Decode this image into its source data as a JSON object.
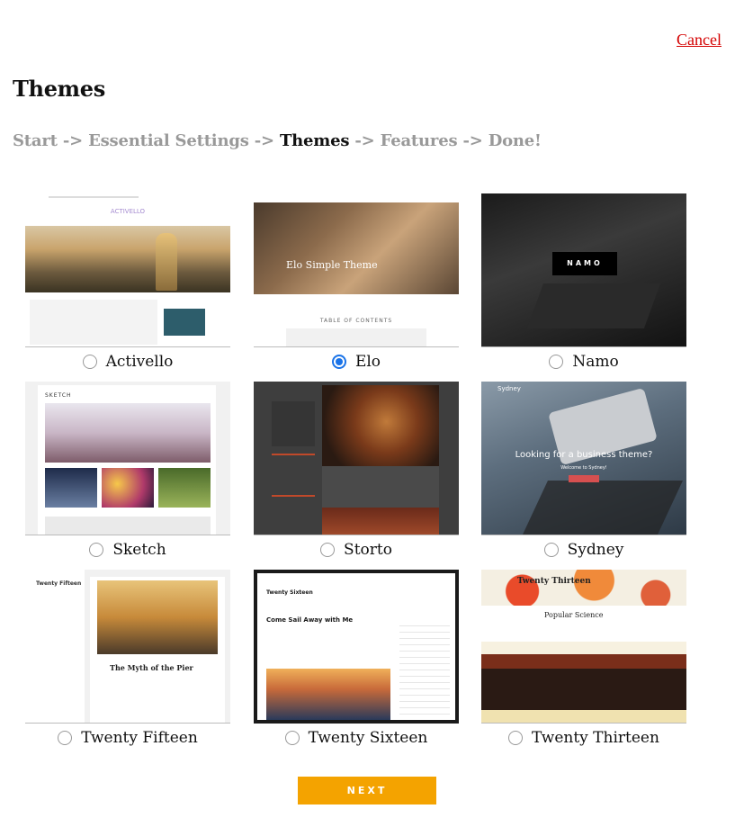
{
  "header": {
    "cancel_label": "Cancel",
    "title": "Themes"
  },
  "steps": {
    "s1": "Start",
    "s2": "Essential Settings",
    "s3": "Themes",
    "s4": "Features",
    "s5": "Done!",
    "sep": " -> "
  },
  "themes": [
    {
      "label": "Activello",
      "selected": false
    },
    {
      "label": "Elo",
      "selected": true
    },
    {
      "label": "Namo",
      "selected": false
    },
    {
      "label": "Sketch",
      "selected": false
    },
    {
      "label": "Storto",
      "selected": false
    },
    {
      "label": "Sydney",
      "selected": false
    },
    {
      "label": "Twenty Fifteen",
      "selected": false
    },
    {
      "label": "Twenty Sixteen",
      "selected": false
    },
    {
      "label": "Twenty Thirteen",
      "selected": false
    }
  ],
  "previews": {
    "activello_logo": "ACTIVELLO",
    "elo_heading": "Elo Simple Theme",
    "elo_toc": "TABLE OF CONTENTS",
    "namo_logo": "NAMO",
    "sketch_logo": "SKETCH",
    "sydney_logo": "Sydney",
    "sydney_headline": "Looking for a business theme?",
    "sydney_sub": "Welcome to Sydney!",
    "fifteen_site": "Twenty Fifteen",
    "fifteen_post": "The Myth of the Pier",
    "sixteen_site": "Twenty Sixteen",
    "sixteen_post": "Come Sail Away with Me",
    "thirteen_site": "Twenty Thirteen",
    "thirteen_post": "Popular Science"
  },
  "next_label": "NEXT"
}
